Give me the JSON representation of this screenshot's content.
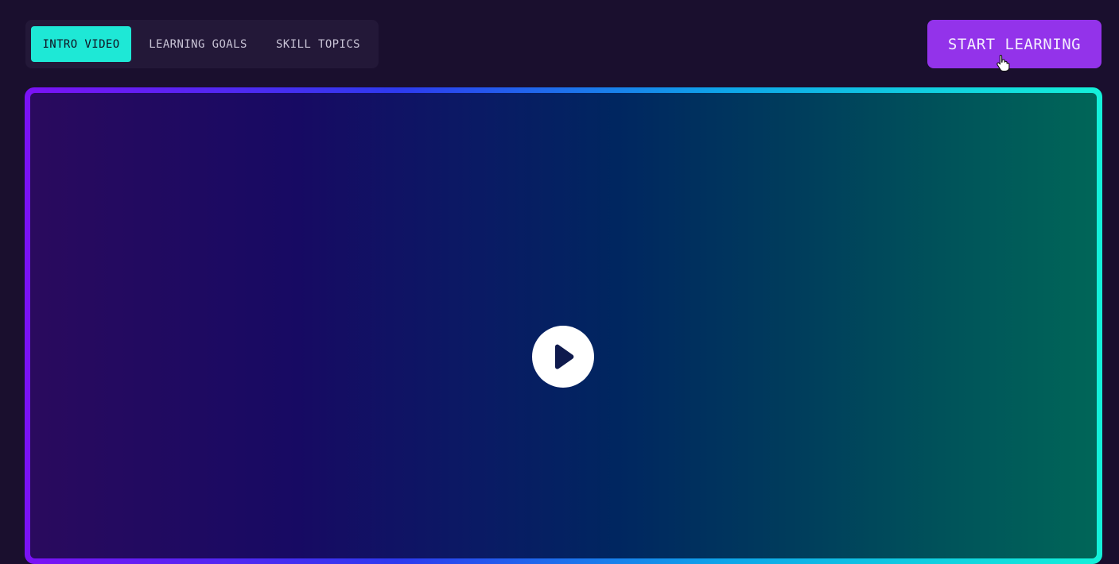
{
  "nav": {
    "tabs": [
      {
        "label": "INTRO VIDEO",
        "active": true
      },
      {
        "label": "LEARNING GOALS",
        "active": false
      },
      {
        "label": "SKILL TOPICS",
        "active": false
      }
    ]
  },
  "cta": {
    "label": "START LEARNING"
  },
  "video": {
    "play_icon": "play-icon"
  },
  "colors": {
    "background": "#1a0f2e",
    "tab_active": "#1ee8d6",
    "cta": "#9333ea"
  }
}
